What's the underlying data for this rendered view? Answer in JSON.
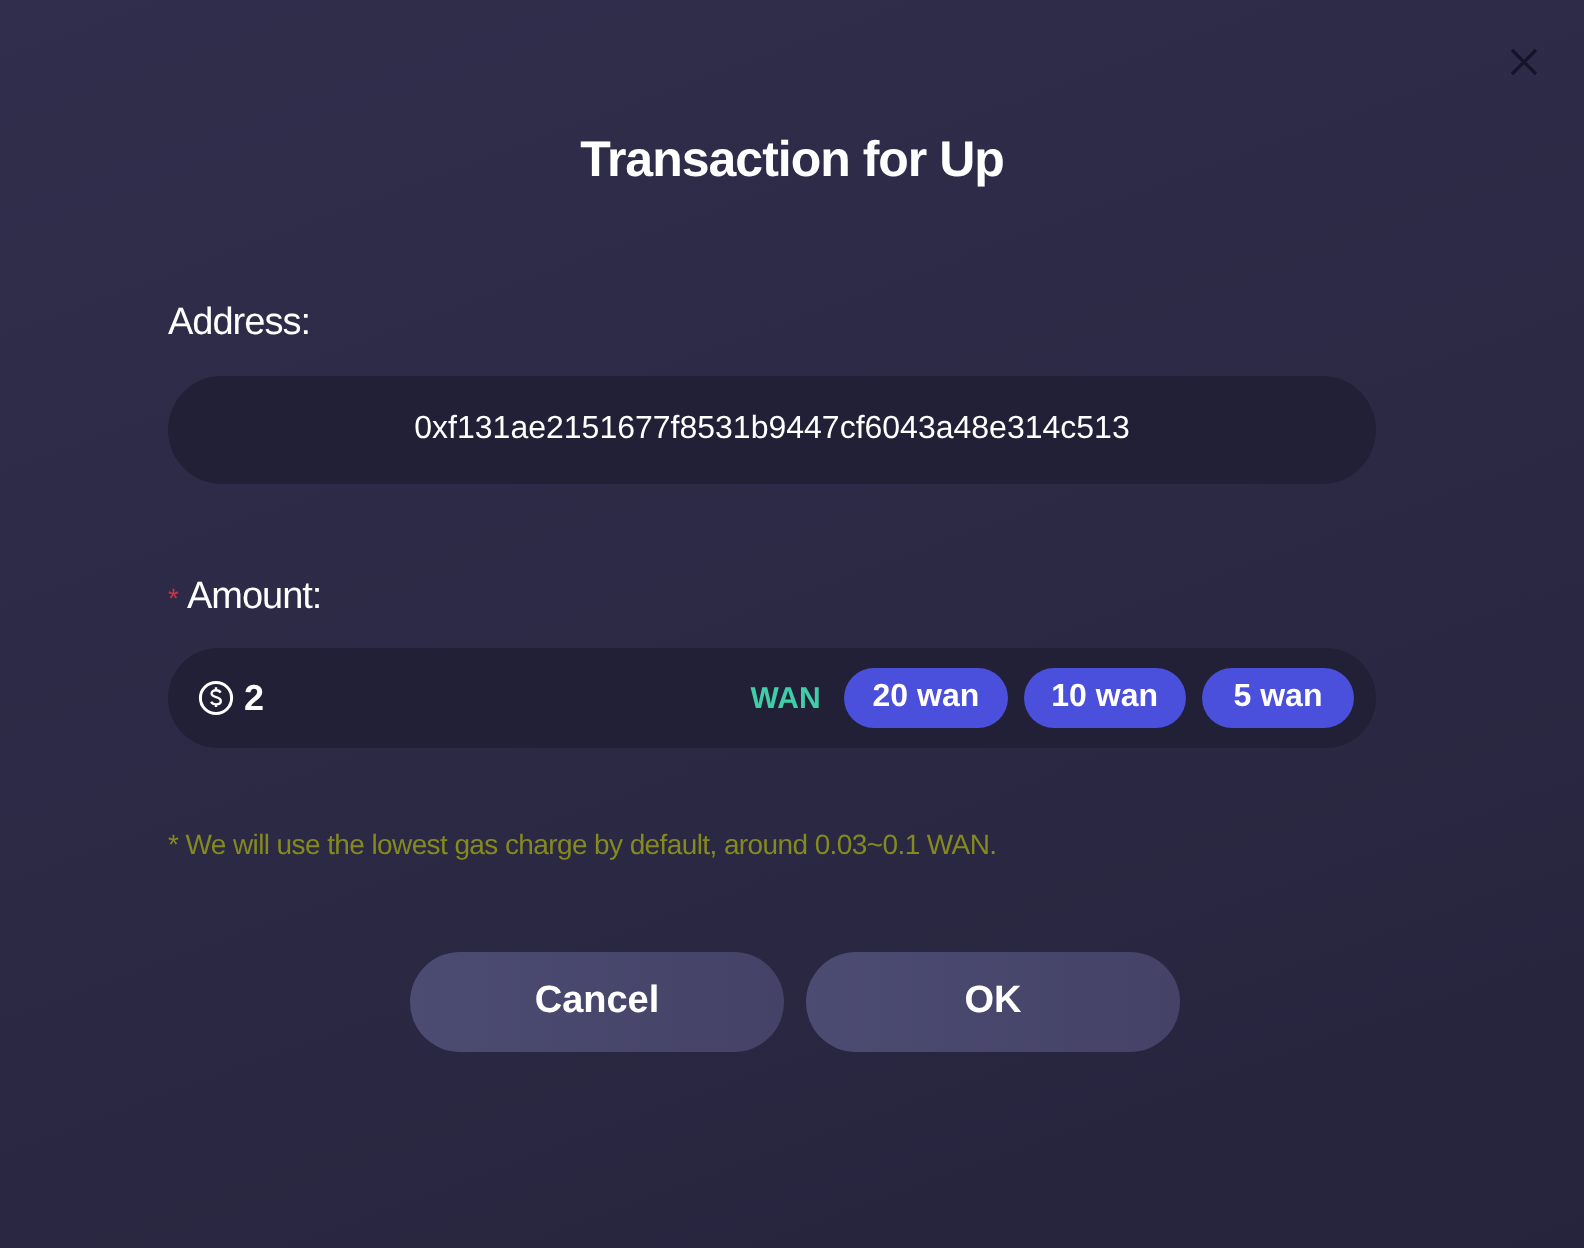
{
  "dialog": {
    "title": "Transaction for Up"
  },
  "address": {
    "label": "Address:",
    "value": "0xf131ae2151677f8531b9447cf6043a48e314c513"
  },
  "amount": {
    "required_mark": "*",
    "label": "Amount:",
    "value": "2",
    "unit": "WAN",
    "presets": [
      "20 wan",
      "10 wan",
      "5 wan"
    ]
  },
  "note": "* We will use the lowest gas charge by default, around 0.03~0.1 WAN.",
  "buttons": [
    "Cancel",
    "OK"
  ]
}
